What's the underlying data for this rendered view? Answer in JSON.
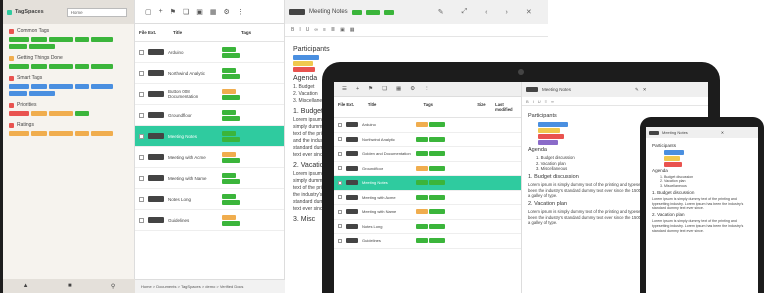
{
  "desktop": {
    "app_name": "TagSpaces",
    "location_select": "Home",
    "sidebar_groups": [
      {
        "title": "Common Tags",
        "color": "#e9534f",
        "tags": [
          "#3bb53b",
          "#3bb53b",
          "#3bb53b",
          "#3bb53b",
          "#3bb53b",
          "#3bb53b",
          "#3bb53b"
        ]
      },
      {
        "title": "Getting Things Done",
        "color": "#f0ad4e",
        "tags": [
          "#3bb53b",
          "#3bb53b",
          "#3bb53b",
          "#3bb53b",
          "#3bb53b"
        ]
      },
      {
        "title": "Smart Tags",
        "color": "#e9534f",
        "tags": [
          "#4a8fe0",
          "#4a8fe0",
          "#4a8fe0",
          "#4a8fe0",
          "#4a8fe0",
          "#4a8fe0",
          "#4a8fe0"
        ]
      },
      {
        "title": "Priorities",
        "color": "#e9534f",
        "tags": [
          "#e9534f",
          "#f0ad4e",
          "#f0ad4e",
          "#3bb53b"
        ]
      },
      {
        "title": "Ratings",
        "color": "#e9534f",
        "tags": [
          "#f0ad4e",
          "#f0ad4e",
          "#f0ad4e",
          "#f0ad4e",
          "#f0ad4e"
        ]
      }
    ],
    "list_headers": {
      "ext": "File Ext.",
      "title": "Title",
      "tags": "Tags"
    },
    "rows": [
      {
        "title": "Arduino",
        "selected": false
      },
      {
        "title": "Northwind Analytic",
        "selected": false
      },
      {
        "title": "Button 008 Documentation",
        "selected": false
      },
      {
        "title": "Groundfloor",
        "selected": false
      },
      {
        "title": "Meeting Notes",
        "selected": true
      },
      {
        "title": "Meeting with Acme",
        "selected": false
      },
      {
        "title": "Meeting with Name",
        "selected": false
      },
      {
        "title": "Notes Long",
        "selected": false
      },
      {
        "title": "Guidelines",
        "selected": false
      }
    ],
    "breadcrumb": "Home > Documents > TagSpaces > demo > Verified Docs",
    "editor_title": "Meeting Notes",
    "doc": {
      "participants_heading": "Participants",
      "agenda_heading": "Agenda",
      "agenda_items": [
        "1. Budget",
        "2. Vacation",
        "3. Miscellaneous"
      ],
      "section_1": "1. Budget",
      "section_2": "2. Vacation",
      "section_3": "3. Misc",
      "para_1": "Lorem ipsum is simply dummy text of the printing and the industry's standard dummy text ever since ...",
      "para_2": "Lorem ipsum is simply dummy text of the printing the industry's standard dummy text ever since..."
    }
  },
  "tablet": {
    "headers": {
      "ext": "File Ext.",
      "title": "Title",
      "tags": "Tags",
      "size": "Size",
      "date": "Last modified"
    },
    "rows": [
      {
        "title": "Arduino",
        "size": "",
        "date": "",
        "selected": false
      },
      {
        "title": "Northwind Analytic",
        "size": "",
        "date": "",
        "selected": false
      },
      {
        "title": "Golden and Documentation",
        "size": "",
        "date": "",
        "selected": false
      },
      {
        "title": "Groundfloor",
        "size": "",
        "date": "",
        "selected": false
      },
      {
        "title": "Meeting Notes",
        "size": "",
        "date": "",
        "selected": true
      },
      {
        "title": "Meeting with Acme",
        "size": "",
        "date": "",
        "selected": false
      },
      {
        "title": "Meeting with Name",
        "size": "",
        "date": "",
        "selected": false
      },
      {
        "title": "Notes Long",
        "size": "",
        "date": "",
        "selected": false
      },
      {
        "title": "Guidelines",
        "size": "",
        "date": "",
        "selected": false
      }
    ],
    "editor_title": "Meeting Notes",
    "doc": {
      "participants_heading": "Participants",
      "agenda_heading": "Agenda",
      "agenda_items": [
        "1. Budget discussion",
        "2. Vacation plan",
        "3. Miscellaneous"
      ],
      "section_1": "1. Budget discussion",
      "section_2": "2. Vacation plan",
      "para": "Lorem ipsum is simply dummy text of the printing and typesetting industry. Lorem ipsum has been the industry's standard dummy text ever since the 1500s, when an unknown printer took a galley of type."
    }
  },
  "phone": {
    "editor_title": "Meeting Notes",
    "doc": {
      "participants_heading": "Participants",
      "agenda_heading": "Agenda",
      "agenda_items": [
        "1. Budget discussion",
        "2. Vacation plan",
        "3. Miscellaneous"
      ],
      "section_1": "1. Budget discussion",
      "section_2": "2. Vacation plan",
      "para": "Lorem ipsum is simply dummy text of the printing and typesetting industry. Lorem ipsum has been the industry's standard dummy text ever since."
    }
  }
}
